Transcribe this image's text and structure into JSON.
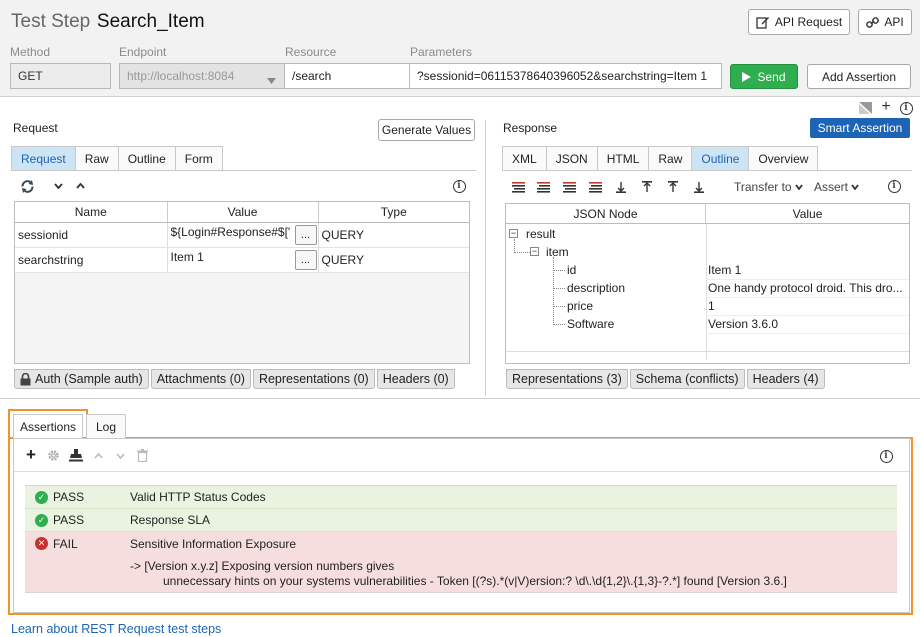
{
  "header": {
    "title_prefix": "Test Step",
    "title_name": "Search_Item",
    "api_request_label": "API Request",
    "api_label": "API"
  },
  "fields": {
    "method_label": "Method",
    "method_value": "GET",
    "endpoint_label": "Endpoint",
    "endpoint_value": "http://localhost:8084",
    "resource_label": "Resource",
    "resource_value": "/search",
    "parameters_label": "Parameters",
    "parameters_value": "?sessionid=06115378640396052&searchstring=Item 1",
    "send_label": "Send",
    "add_assertion_label": "Add Assertion"
  },
  "request": {
    "title": "Request",
    "generate_values_label": "Generate Values",
    "tabs": [
      "Request",
      "Raw",
      "Outline",
      "Form"
    ],
    "columns": [
      "Name",
      "Value",
      "Type"
    ],
    "rows": [
      {
        "name": "sessionid",
        "value": "${Login#Response#$['",
        "type": "QUERY"
      },
      {
        "name": "searchstring",
        "value": "Item 1",
        "type": "QUERY"
      }
    ],
    "dots_label": "...",
    "bottom_tabs": [
      "Auth (Sample auth)",
      "Attachments (0)",
      "Representations (0)",
      "Headers (0)"
    ]
  },
  "response": {
    "title": "Response",
    "smart_assertion_label": "Smart Assertion",
    "tabs": [
      "XML",
      "JSON",
      "HTML",
      "Raw",
      "Outline",
      "Overview"
    ],
    "transfer_label": "Transfer to",
    "assert_label": "Assert",
    "columns": [
      "JSON Node",
      "Value"
    ],
    "tree": {
      "root": "result",
      "child": "item",
      "leaves": [
        {
          "name": "id",
          "value": "Item 1"
        },
        {
          "name": "description",
          "value": "One handy protocol droid. This dro..."
        },
        {
          "name": "price",
          "value": "1"
        },
        {
          "name": "Software",
          "value": "Version 3.6.0"
        }
      ]
    },
    "bottom_tabs": [
      "Representations (3)",
      "Schema (conflicts)",
      "Headers (4)"
    ]
  },
  "assertions": {
    "tabs": [
      "Assertions",
      "Log"
    ],
    "items": [
      {
        "status": "PASS",
        "name": "Valid HTTP Status Codes"
      },
      {
        "status": "PASS",
        "name": "Response SLA"
      },
      {
        "status": "FAIL",
        "name": "Sensitive Information Exposure",
        "detail_line1": "-> [Version x.y.z] Exposing version numbers gives",
        "detail_line2": "unnecessary hints on your systems vulnerabilities - Token [(?s).*(v|V)ersion:? \\d\\.\\d{1,2}\\.{1,3}-?.*] found [Version 3.6.]"
      }
    ]
  },
  "footer": {
    "learn_link": "Learn about REST Request test steps"
  },
  "colors": {
    "accent": "#1d64b5",
    "send": "#2eae4e",
    "highlight_border": "#f0922e",
    "pass": "#2eae4e",
    "fail": "#c9302c"
  }
}
